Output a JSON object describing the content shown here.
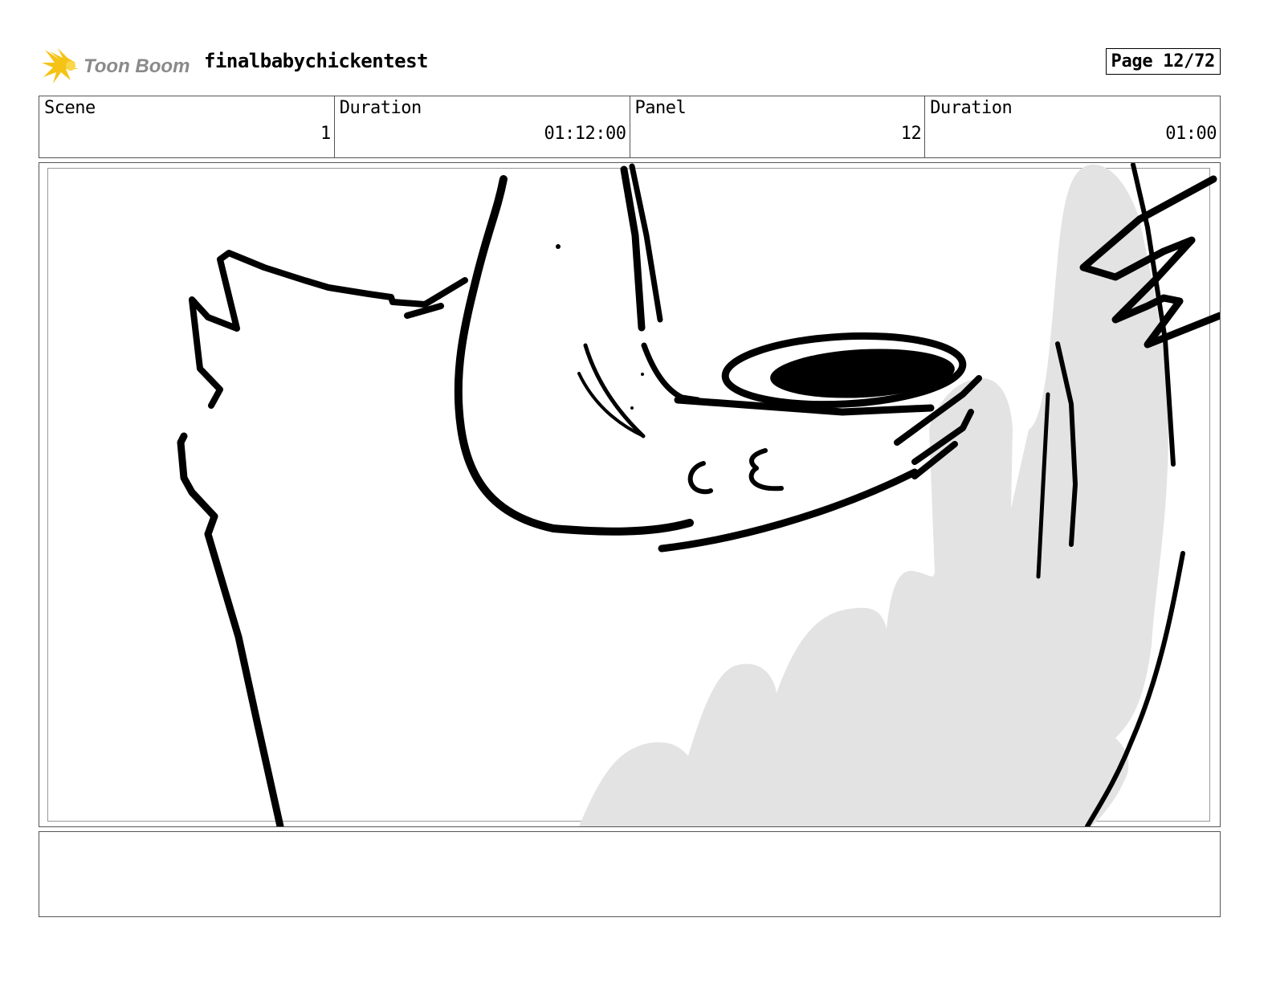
{
  "header": {
    "logo_alt": "Toon Boom",
    "project_title": "finalbabychickentest",
    "page_label": "Page 12/72"
  },
  "info": {
    "scene_label": "Scene",
    "scene_value": "1",
    "scene_duration_label": "Duration",
    "scene_duration_value": "01:12:00",
    "panel_label": "Panel",
    "panel_value": "12",
    "panel_duration_label": "Duration",
    "panel_duration_value": "01:00"
  },
  "notes": {
    "text": ""
  },
  "colors": {
    "logo_yellow": "#f5c316",
    "logo_gray": "#8a8a8a",
    "shading": "#e3e3e3",
    "ink": "#000000"
  }
}
